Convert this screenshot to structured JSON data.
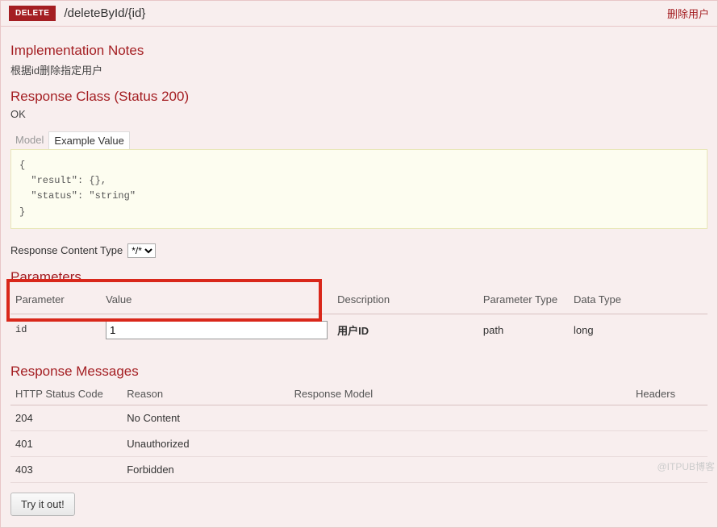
{
  "header": {
    "method": "DELETE",
    "path": "/deleteById/{id}",
    "summary": "删除用户"
  },
  "implementation": {
    "title": "Implementation Notes",
    "text": "根据id删除指定用户"
  },
  "responseClass": {
    "title": "Response Class (Status 200)",
    "status": "OK"
  },
  "tabs": {
    "model": "Model",
    "example": "Example Value"
  },
  "exampleValue": "{\n  \"result\": {},\n  \"status\": \"string\"\n}",
  "contentType": {
    "label": "Response Content Type",
    "value": "*/*"
  },
  "parameters": {
    "title": "Parameters",
    "headers": {
      "parameter": "Parameter",
      "value": "Value",
      "description": "Description",
      "paramType": "Parameter Type",
      "dataType": "Data Type"
    },
    "rows": [
      {
        "name": "id",
        "value": "1",
        "description": "用户ID",
        "paramType": "path",
        "dataType": "long"
      }
    ]
  },
  "responseMessages": {
    "title": "Response Messages",
    "headers": {
      "code": "HTTP Status Code",
      "reason": "Reason",
      "model": "Response Model",
      "headers": "Headers"
    },
    "rows": [
      {
        "code": "204",
        "reason": "No Content"
      },
      {
        "code": "401",
        "reason": "Unauthorized"
      },
      {
        "code": "403",
        "reason": "Forbidden"
      }
    ]
  },
  "tryButton": "Try it out!",
  "watermark": "@ITPUB博客"
}
